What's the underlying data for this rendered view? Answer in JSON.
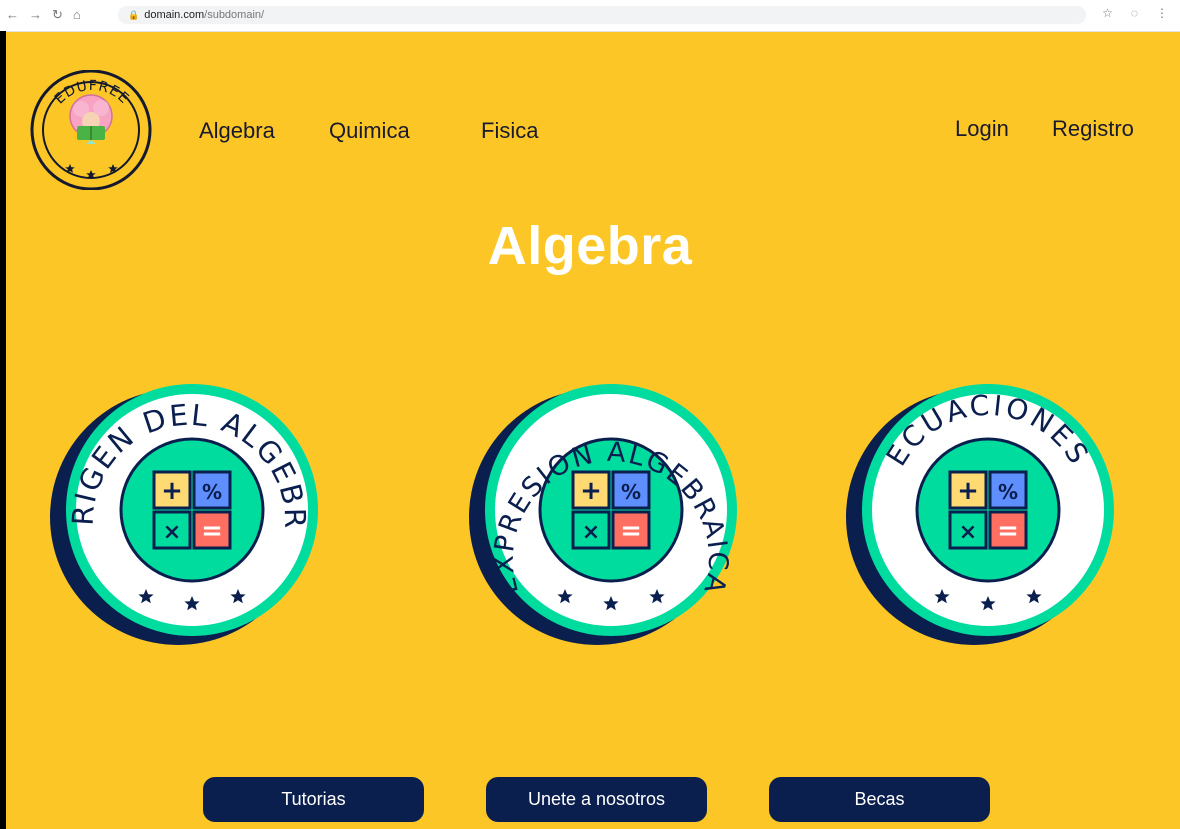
{
  "browser": {
    "url_host": "domain.com",
    "url_path": "/subdomain/"
  },
  "logo": {
    "text": "EDUFREE"
  },
  "nav": [
    {
      "label": "Algebra"
    },
    {
      "label": "Quimica"
    },
    {
      "label": "Fisica"
    }
  ],
  "auth": {
    "login": "Login",
    "register": "Registro"
  },
  "page_title": "Algebra",
  "badges": [
    {
      "label": "ORIGEN DEL ALGEBRA"
    },
    {
      "label": "EXPRESION ALGEBRAICA"
    },
    {
      "label": "ECUACIONES"
    }
  ],
  "footer": {
    "tutorials": "Tutorias",
    "join": "Unete a nosotros",
    "scholarships": "Becas"
  },
  "colors": {
    "background": "#fcc726",
    "navy": "#0b1f4f",
    "teal": "#00dc9e",
    "white": "#ffffff"
  }
}
